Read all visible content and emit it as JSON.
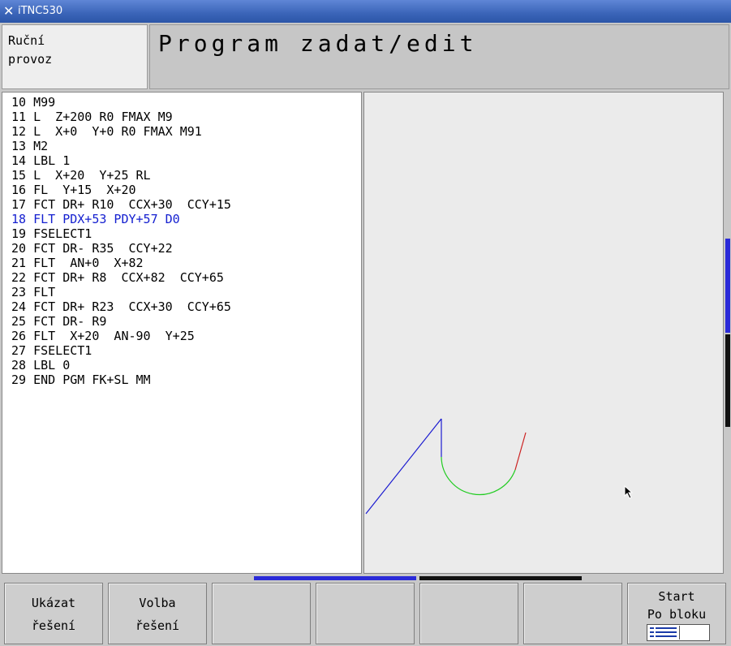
{
  "window": {
    "title": "iTNC530"
  },
  "header": {
    "machine_mode_line1": "Ruční",
    "machine_mode_line2": "provoz",
    "programming_mode": "Program zadat/edit"
  },
  "program": {
    "active_index": 8,
    "lines": [
      "10 M99",
      "11 L  Z+200 R0 FMAX M9",
      "12 L  X+0  Y+0 R0 FMAX M91",
      "13 M2",
      "14 LBL 1",
      "15 L  X+20  Y+25 RL",
      "16 FL  Y+15  X+20",
      "17 FCT DR+ R10  CCX+30  CCY+15",
      "18 FLT PDX+53 PDY+57 D0",
      "19 FSELECT1",
      "20 FCT DR- R35  CCY+22",
      "21 FLT  AN+0  X+82",
      "22 FCT DR+ R8  CCX+82  CCY+65",
      "23 FLT",
      "24 FCT DR+ R23  CCX+30  CCY+65",
      "25 FCT DR- R9",
      "26 FLT  X+20  AN-90  Y+25",
      "27 FSELECT1",
      "28 LBL 0",
      "29 END PGM FK+SL MM"
    ]
  },
  "graphic": {
    "colors": {
      "line": "#1a1ad0",
      "arc": "#22cc22",
      "open": "#cc2222",
      "background": "#ebebeb"
    }
  },
  "softkeys": [
    {
      "line1": "Ukázat",
      "line2": "řešení"
    },
    {
      "line1": "Volba",
      "line2": "řešení"
    },
    {
      "line1": "",
      "line2": ""
    },
    {
      "line1": "",
      "line2": ""
    },
    {
      "line1": "",
      "line2": ""
    },
    {
      "line1": "",
      "line2": ""
    },
    {
      "line1": "Start",
      "line2": "Po bloku",
      "icon": "block-scan-icon"
    }
  ]
}
